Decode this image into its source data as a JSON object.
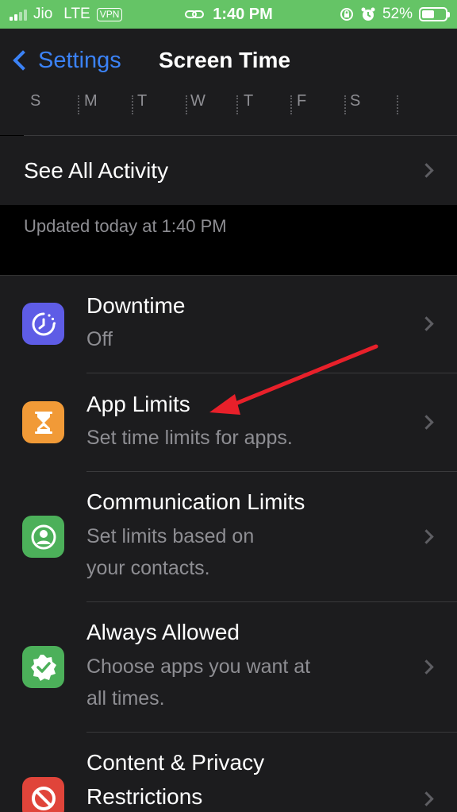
{
  "status": {
    "carrier": "Jio",
    "network": "LTE",
    "vpn": "VPN",
    "time": "1:40 PM",
    "battery_percent_label": "52%",
    "battery_level": 0.52
  },
  "nav": {
    "back_label": "Settings",
    "title": "Screen Time"
  },
  "week": {
    "days": [
      "S",
      "M",
      "T",
      "W",
      "T",
      "F",
      "S"
    ]
  },
  "see_all": {
    "label": "See All Activity"
  },
  "updated_text": "Updated today at 1:40 PM",
  "rows": [
    {
      "title": "Downtime",
      "subtitle": "Off",
      "icon": "downtime-icon",
      "color": "#5e5ce6"
    },
    {
      "title": "App Limits",
      "subtitle": "Set time limits for apps.",
      "icon": "hourglass-icon",
      "color": "#f19a37"
    },
    {
      "title": "Communication Limits",
      "subtitle_line1": "Set limits based on",
      "subtitle_line2": "your contacts.",
      "icon": "person-circle-icon",
      "color": "#4cb05a"
    },
    {
      "title": "Always Allowed",
      "subtitle_line1": "Choose apps you want at",
      "subtitle_line2": "all times.",
      "icon": "checkmark-badge-icon",
      "color": "#4cb05a"
    },
    {
      "title_line1": "Content & Privacy",
      "title_line2": "Restrictions",
      "icon": "restricted-icon",
      "color": "#e0443a"
    }
  ],
  "annotation": {
    "color": "#e8202a"
  }
}
